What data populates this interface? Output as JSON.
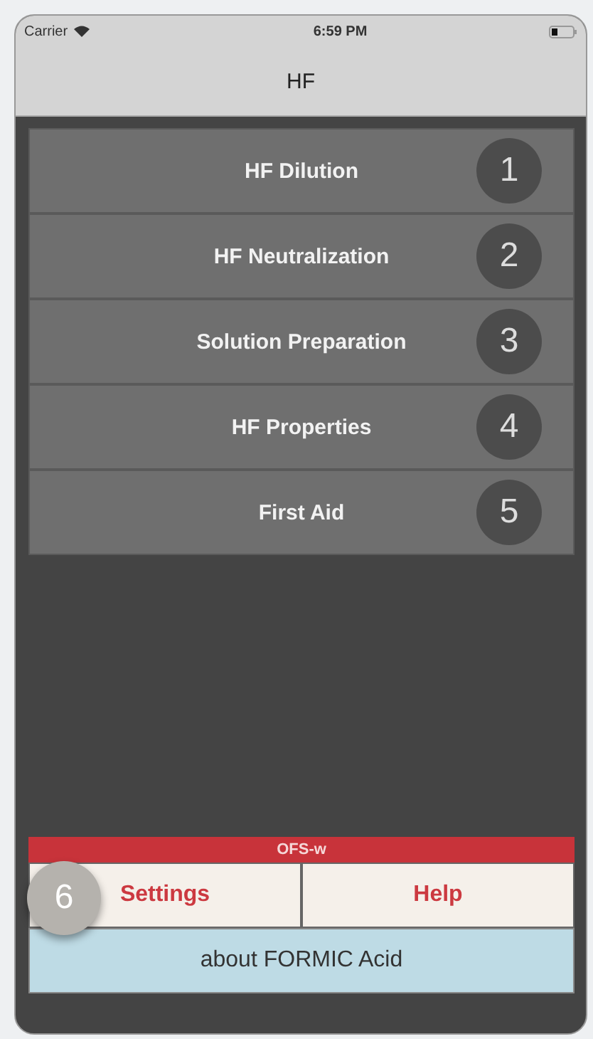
{
  "status_bar": {
    "carrier": "Carrier",
    "time": "6:59 PM"
  },
  "nav": {
    "title": "HF"
  },
  "menu": [
    {
      "label": "HF Dilution",
      "badge": "1"
    },
    {
      "label": "HF Neutralization",
      "badge": "2"
    },
    {
      "label": "Solution Preparation",
      "badge": "3"
    },
    {
      "label": "HF Properties",
      "badge": "4"
    },
    {
      "label": "First Aid",
      "badge": "5"
    }
  ],
  "brand_bar": "OFS-w",
  "footer_buttons": [
    {
      "label": "Settings",
      "badge": "6"
    },
    {
      "label": "Help"
    }
  ],
  "about_button": "about FORMIC Acid"
}
